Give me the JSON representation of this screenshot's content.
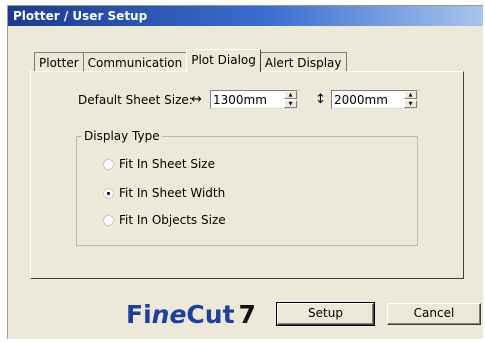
{
  "window": {
    "title": "Plotter / User Setup"
  },
  "tabs": [
    {
      "label": "Plotter",
      "active": false
    },
    {
      "label": "Communication",
      "active": false
    },
    {
      "label": "Plot Dialog",
      "active": true
    },
    {
      "label": "Alert Display",
      "active": false
    }
  ],
  "sheet_size": {
    "label": "Default Sheet Size:",
    "width_icon": "horizontal-arrow-icon",
    "width_glyph": "↔",
    "width_value": "1300mm",
    "height_icon": "vertical-arrow-icon",
    "height_glyph": "↕",
    "height_value": "2000mm"
  },
  "display_type": {
    "legend": "Display Type",
    "options": [
      {
        "label": "Fit In Sheet Size",
        "selected": false
      },
      {
        "label": "Fit In Sheet Width",
        "selected": true
      },
      {
        "label": "Fit In Objects Size",
        "selected": false
      }
    ]
  },
  "logo": {
    "part1": "Fi",
    "part2": "ne",
    "part3": "Cut",
    "part4": "7"
  },
  "buttons": {
    "setup": "Setup",
    "cancel": "Cancel"
  },
  "colors": {
    "title_bar": "#1c3b8e",
    "dialog_bg": "#ece9d8",
    "logo_blue": "#1f3f9e"
  }
}
